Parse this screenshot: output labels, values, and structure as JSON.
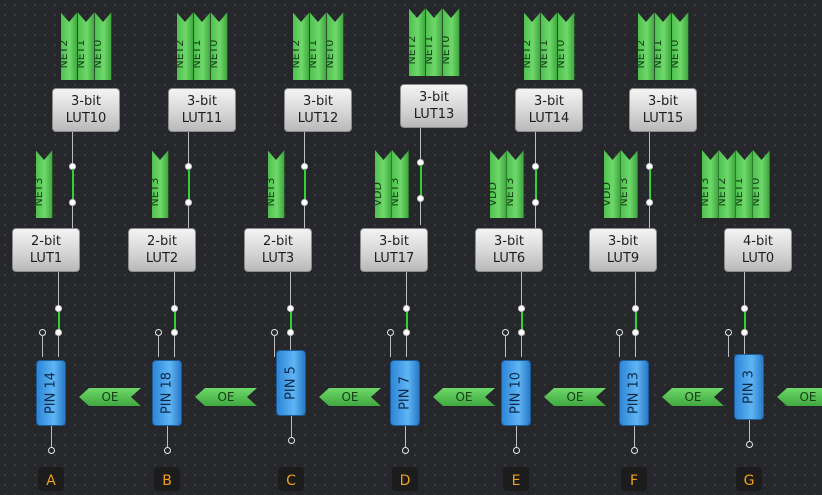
{
  "columns": [
    {
      "label": "A",
      "pin": "PIN 14",
      "oe": "OE",
      "lower": {
        "bits": "2-bit",
        "name": "LUT1",
        "nets": [
          "NET3"
        ]
      },
      "upper": {
        "bits": "3-bit",
        "name": "LUT10",
        "nets": [
          "NET2",
          "NET1",
          "NET0"
        ]
      }
    },
    {
      "label": "B",
      "pin": "PIN 18",
      "oe": "OE",
      "lower": {
        "bits": "2-bit",
        "name": "LUT2",
        "nets": [
          "NET3"
        ]
      },
      "upper": {
        "bits": "3-bit",
        "name": "LUT11",
        "nets": [
          "NET2",
          "NET1",
          "NET0"
        ]
      }
    },
    {
      "label": "C",
      "pin": "PIN 5",
      "oe": "OE",
      "lower": {
        "bits": "2-bit",
        "name": "LUT3",
        "nets": [
          "NET3"
        ]
      },
      "upper": {
        "bits": "3-bit",
        "name": "LUT12",
        "nets": [
          "NET2",
          "NET1",
          "NET0"
        ]
      }
    },
    {
      "label": "D",
      "pin": "PIN 7",
      "oe": "OE",
      "lower": {
        "bits": "3-bit",
        "name": "LUT17",
        "nets": [
          "VDD",
          "NET3"
        ]
      },
      "upper": {
        "bits": "3-bit",
        "name": "LUT13",
        "nets": [
          "NET2",
          "NET1",
          "NET0"
        ]
      }
    },
    {
      "label": "E",
      "pin": "PIN 10",
      "oe": "OE",
      "lower": {
        "bits": "3-bit",
        "name": "LUT6",
        "nets": [
          "VDD",
          "NET3"
        ]
      },
      "upper": {
        "bits": "3-bit",
        "name": "LUT14",
        "nets": [
          "NET2",
          "NET1",
          "NET0"
        ]
      }
    },
    {
      "label": "F",
      "pin": "PIN 13",
      "oe": "OE",
      "lower": {
        "bits": "3-bit",
        "name": "LUT9",
        "nets": [
          "VDD",
          "NET3"
        ]
      },
      "upper": {
        "bits": "3-bit",
        "name": "LUT15",
        "nets": [
          "NET2",
          "NET1",
          "NET0"
        ]
      }
    },
    {
      "label": "G",
      "pin": "PIN 3",
      "oe": "OE",
      "lower": {
        "bits": "4-bit",
        "name": "LUT0",
        "nets": [
          "NET3",
          "NET2",
          "NET1",
          "NET0"
        ]
      },
      "upper": null
    }
  ],
  "colors": {
    "background": "#25272a",
    "net_tag": "#5cc85a",
    "pin": "#4aa6ee",
    "lut": "#d4d4d4",
    "wire_active": "#35d035",
    "column_label": "#f0a018"
  }
}
